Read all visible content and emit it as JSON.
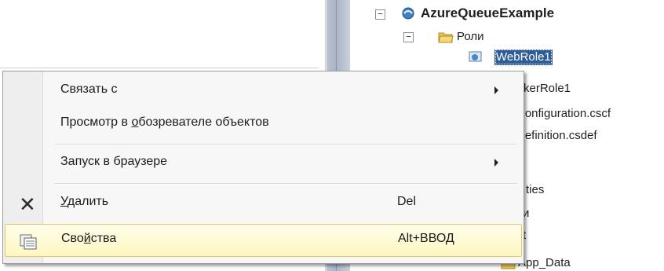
{
  "solution_explorer": {
    "project_name": "AzureQueueExample",
    "roles_folder": "Роли",
    "items": {
      "webrole": "WebRole1",
      "workerrole_partial": "rkerRole1",
      "config_partial": "Configuration.cscf",
      "definition_partial": "Definition.csdef",
      "properties_partial": "ties",
      "item_partial_1": "и",
      "item_partial_2": "t",
      "app_data_partial": "App_Data"
    },
    "expander_symbol": "⊟"
  },
  "context_menu": {
    "items": [
      {
        "label_pre": "Связать с",
        "label_u": "",
        "label_post": "",
        "shortcut": "",
        "submenu": true,
        "icon": ""
      },
      {
        "label_pre": "Просмотр в ",
        "label_u": "о",
        "label_post": "бозревателе объектов",
        "shortcut": "",
        "submenu": false,
        "icon": ""
      },
      {
        "label_pre": "Запуск в браузере",
        "label_u": "",
        "label_post": "",
        "shortcut": "",
        "submenu": true,
        "icon": ""
      },
      {
        "label_pre": "",
        "label_u": "У",
        "label_post": "далить",
        "shortcut": "Del",
        "submenu": false,
        "icon": "delete-x-icon",
        "icon_glyph": "✕"
      },
      {
        "label_pre": "Сво",
        "label_u": "й",
        "label_post": "ства",
        "shortcut": "Alt+ВВОД",
        "submenu": false,
        "icon": "properties-icon",
        "highlighted": true
      }
    ]
  },
  "colors": {
    "selection": "#2f5d9a",
    "menu_highlight_border": "#e2c86b",
    "menu_highlight_fill": "#fff7c2"
  }
}
